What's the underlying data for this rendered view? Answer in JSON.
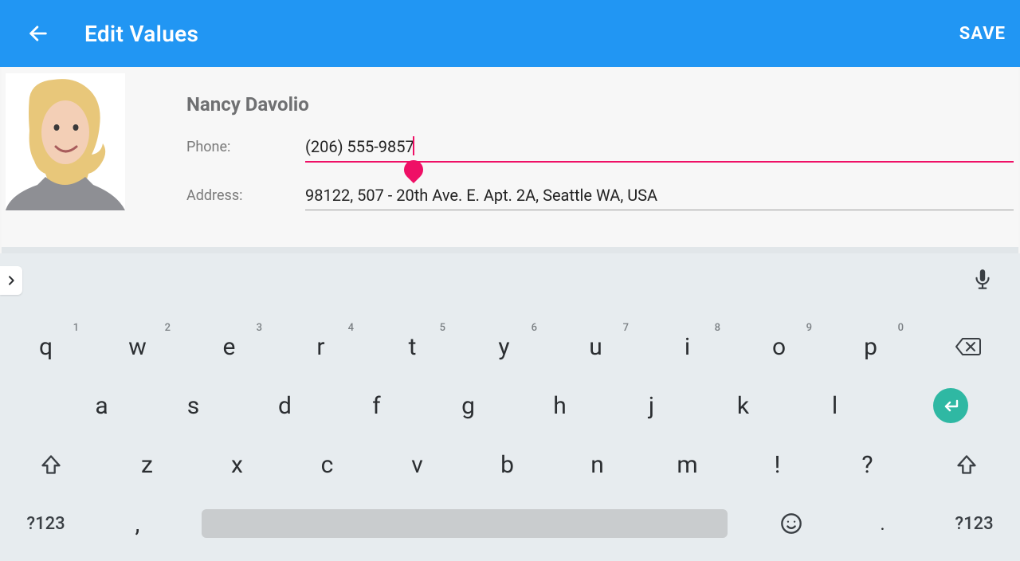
{
  "header": {
    "title": "Edit Values",
    "save_label": "SAVE"
  },
  "contact": {
    "name": "Nancy Davolio",
    "phone_label": "Phone:",
    "phone_value": "(206) 555-9857",
    "address_label": "Address:",
    "address_value": "98122, 507 - 20th Ave. E. Apt. 2A, Seattle WA, USA"
  },
  "keyboard": {
    "row1": [
      {
        "k": "q",
        "alt": "1"
      },
      {
        "k": "w",
        "alt": "2"
      },
      {
        "k": "e",
        "alt": "3"
      },
      {
        "k": "r",
        "alt": "4"
      },
      {
        "k": "t",
        "alt": "5"
      },
      {
        "k": "y",
        "alt": "6"
      },
      {
        "k": "u",
        "alt": "7"
      },
      {
        "k": "i",
        "alt": "8"
      },
      {
        "k": "o",
        "alt": "9"
      },
      {
        "k": "p",
        "alt": "0"
      }
    ],
    "row2": [
      "a",
      "s",
      "d",
      "f",
      "g",
      "h",
      "j",
      "k",
      "l"
    ],
    "row3": [
      "z",
      "x",
      "c",
      "v",
      "b",
      "n",
      "m",
      "!",
      "?"
    ],
    "sym_label": "?123",
    "comma": ",",
    "period": "."
  }
}
